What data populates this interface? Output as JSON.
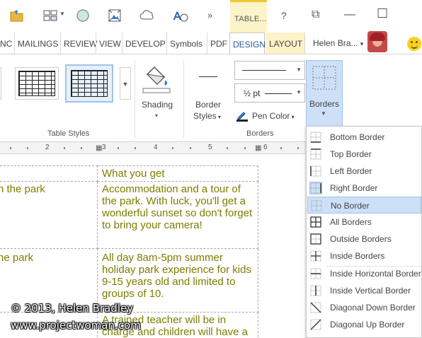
{
  "qat": {
    "icons": [
      "open-folder-icon",
      "grid-view-icon",
      "circle-shape-icon",
      "picture-icon",
      "cloud-shape-icon",
      "text-effects-icon",
      "more-commands-icon"
    ],
    "overflow": "»",
    "context_tab": "TABLE...",
    "help": "?",
    "restore": "⧉",
    "minimize": "—",
    "maximize": "☐"
  },
  "tabs": [
    {
      "label": "NC"
    },
    {
      "label": "MAILINGS"
    },
    {
      "label": "REVIEW"
    },
    {
      "label": "VIEW"
    },
    {
      "label": "DEVELOP"
    },
    {
      "label": "Symbols"
    },
    {
      "label": "PDF"
    },
    {
      "label": "DESIGN",
      "active": true
    },
    {
      "label": "LAYOUT"
    }
  ],
  "user": {
    "name": "Helen Bra...",
    "dropdown": "▾"
  },
  "ribbon": {
    "table_styles_label": "Table Styles",
    "shading_label": "Shading",
    "border_styles_label": "Border",
    "border_styles_label2": "Styles",
    "pen_weight": "½ pt",
    "pen_color_label": "Pen Color",
    "borders_label": "Borders",
    "borders_group_label": "Borders",
    "accent_color": "#2b579a"
  },
  "ruler": {
    "numbers": [
      "2",
      "3",
      "4",
      "5",
      "6"
    ]
  },
  "document": {
    "header_cell": "What you get",
    "rows": [
      {
        "left": "n the park",
        "right": "Accommodation and a tour of the park. With luck, you'll get a wonderful sunset so don't forget to bring your camera!"
      },
      {
        "left": "he park",
        "right": "All day 8am-5pm summer holiday park experience for kids 9-15 years old and limited to groups of 10."
      },
      {
        "left": "",
        "right": "A trained teacher will be in charge and children will have a"
      }
    ],
    "text_color": "#7d7d00"
  },
  "watermark": {
    "line1": "© 2013, Helen Bradley",
    "line2": "www.projectwoman.com"
  },
  "menu": {
    "items": [
      {
        "label": "Bottom Border",
        "icon": "bottom-border-icon"
      },
      {
        "label": "Top Border",
        "icon": "top-border-icon"
      },
      {
        "label": "Left Border",
        "icon": "left-border-icon"
      },
      {
        "label": "Right Border",
        "icon": "right-border-icon",
        "selected": true
      },
      {
        "label": "No Border",
        "icon": "no-border-icon",
        "highlighted": true
      },
      {
        "label": "All Borders",
        "icon": "all-borders-icon"
      },
      {
        "label": "Outside Borders",
        "icon": "outside-borders-icon"
      },
      {
        "label": "Inside Borders",
        "icon": "inside-borders-icon"
      },
      {
        "label": "Inside Horizontal Border",
        "icon": "inside-horizontal-border-icon"
      },
      {
        "label": "Inside Vertical Border",
        "icon": "inside-vertical-border-icon"
      },
      {
        "label": "Diagonal Down Border",
        "icon": "diagonal-down-border-icon"
      },
      {
        "label": "Diagonal Up Border",
        "icon": "diagonal-up-border-icon"
      }
    ]
  }
}
